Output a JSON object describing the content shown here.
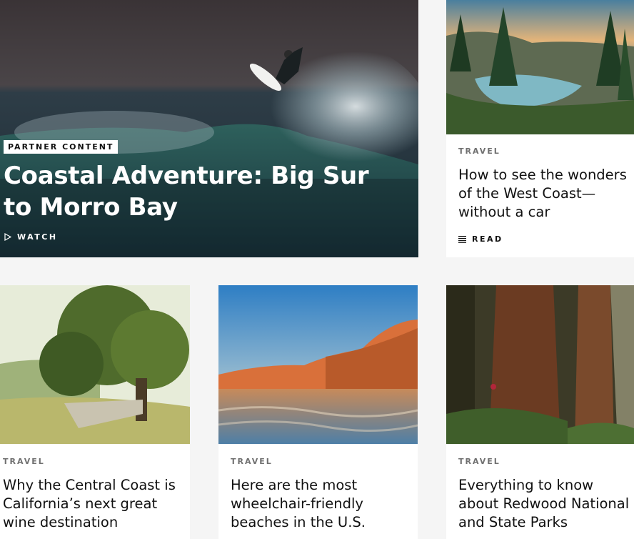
{
  "hero": {
    "badge": "PARTNER CONTENT",
    "title": "Coastal Adventure: Big Sur to Morro Bay",
    "action_label": "WATCH",
    "action_icon": "play-icon"
  },
  "cards": [
    {
      "kicker": "TRAVEL",
      "title": "How to see the wonders of the West Coast—without a car",
      "action_label": "READ",
      "action_icon": "menu-lines-icon",
      "image": "forest-lake-image"
    },
    {
      "kicker": "TRAVEL",
      "title": "Why the Central Coast is California’s next great wine destination",
      "image": "vineyard-oak-image"
    },
    {
      "kicker": "TRAVEL",
      "title": "Here are the most wheelchair-friendly beaches in the U.S.",
      "image": "beach-cliffs-image"
    },
    {
      "kicker": "TRAVEL",
      "title": "Everything to know about Redwood National and State Parks",
      "image": "redwood-forest-image"
    }
  ]
}
